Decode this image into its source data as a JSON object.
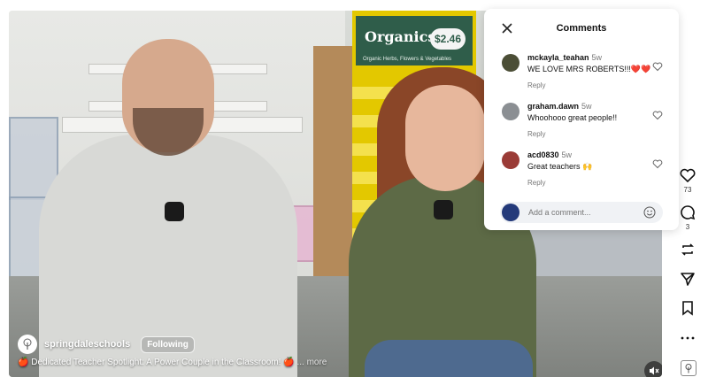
{
  "video": {
    "display_brand": "Organics",
    "display_price": "$2.46",
    "display_tagline": "Organic Herbs, Flowers & Vegetables"
  },
  "post": {
    "username": "springdaleschools",
    "follow_label": "Following",
    "caption_prefix": "🍎",
    "caption_text": "Dedicated Teacher Spotlight: A Power Couple in the Classroom!",
    "caption_suffix": "🍎",
    "more_label": "... more"
  },
  "comments_panel": {
    "title": "Comments",
    "comments": [
      {
        "user": "mckayla_teahan",
        "time": "5w",
        "text": "WE LOVE MRS ROBERTS!!!❤️❤️",
        "reply": "Reply"
      },
      {
        "user": "graham.dawn",
        "time": "5w",
        "text": "Whoohooo great people!!",
        "reply": "Reply"
      },
      {
        "user": "acd0830",
        "time": "5w",
        "text": "Great teachers 🙌",
        "reply": "Reply"
      }
    ],
    "add_comment_placeholder": "Add a comment..."
  },
  "actions": {
    "like_count": "73",
    "comment_count": "3"
  },
  "colors": {
    "overlay_text": "#ffffff",
    "heart_red": "#e0245e",
    "muted": "#777777"
  }
}
